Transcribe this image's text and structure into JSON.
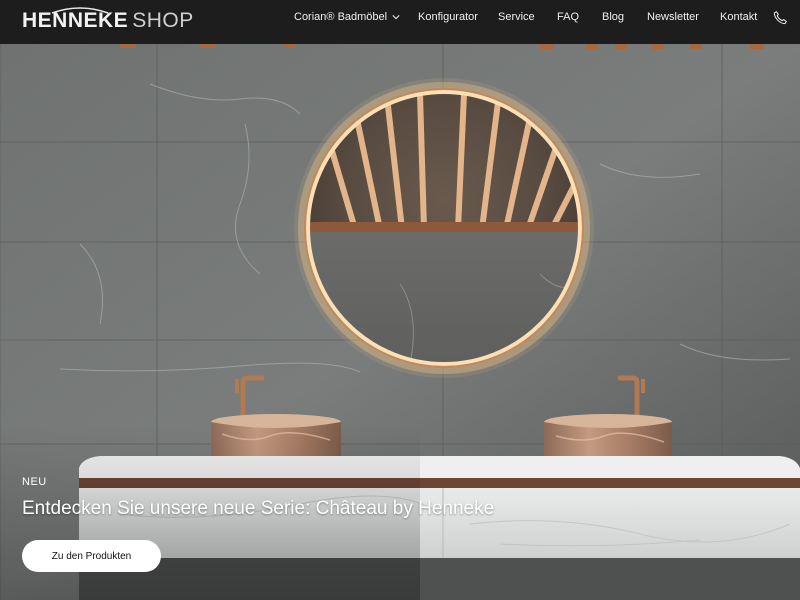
{
  "brand": {
    "name_bold": "HENNEKE",
    "name_light": "SHOP"
  },
  "nav": {
    "items": [
      {
        "label": "Corian® Badmöbel",
        "has_dropdown": true
      },
      {
        "label": "Konfigurator"
      },
      {
        "label": "Service"
      },
      {
        "label": "FAQ"
      },
      {
        "label": "Blog"
      },
      {
        "label": "Newsletter"
      },
      {
        "label": "Kontakt"
      }
    ],
    "phone_icon": "phone-icon"
  },
  "hero": {
    "eyebrow": "NEU",
    "headline": "Entdecken Sie unsere neue Serie: Château by Henneke",
    "cta_label": "Zu den Produkten"
  },
  "colors": {
    "header_bg": "#1d1d1d",
    "wall": "#6e7170",
    "mirror_light": "#f6c98a",
    "copper": "#b07a52",
    "button_bg": "#ffffff"
  }
}
